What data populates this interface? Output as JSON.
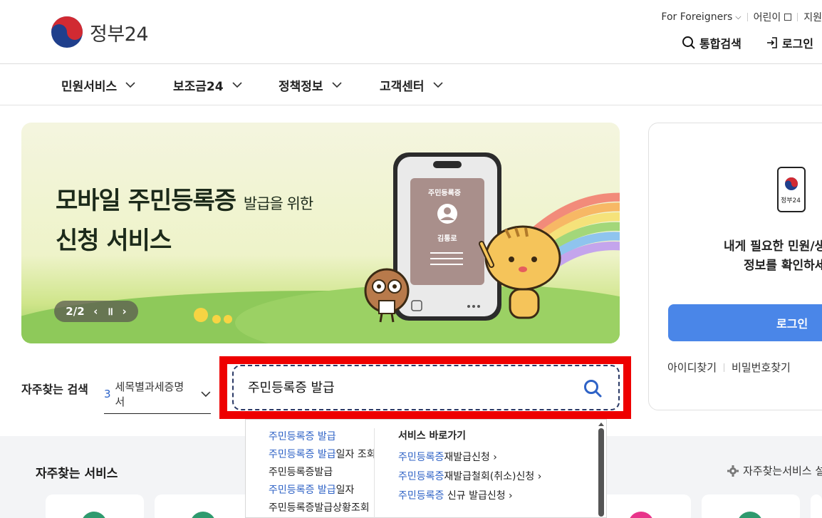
{
  "header": {
    "logo_text": "정부24",
    "util_links": [
      "For Foreigners",
      "어린이",
      "지원"
    ],
    "search_label": "통합검색",
    "login_label": "로그인"
  },
  "gnb": [
    "민원서비스",
    "보조금24",
    "정책정보",
    "고객센터"
  ],
  "banner": {
    "title_main": "모바일 주민등록증",
    "title_small": "발급을 위한",
    "title_line2": "신청 서비스",
    "card_label": "주민등록증",
    "card_name": "김통로",
    "pager": "2/2"
  },
  "login_card": {
    "icon_label": "정부24",
    "message_line1": "내게 필요한 민원/생",
    "message_line2": "정보를 확인하세",
    "login_button": "로그인",
    "find_id": "아이디찾기",
    "find_pw": "비밀번호찾기"
  },
  "search": {
    "freq_label": "자주찾는 검색",
    "freq_num": "3",
    "freq_text": "세목별과세증명서",
    "query": "주민등록증 발급"
  },
  "dropdown": {
    "suggestions": [
      {
        "hl": "주민등록증 발급",
        "rest": ""
      },
      {
        "hl": "주민등록증 발급",
        "rest": "일자 조회"
      },
      {
        "hl": "",
        "rest": "주민등록증발급"
      },
      {
        "hl": "주민등록증 발급",
        "rest": "일자"
      },
      {
        "hl": "",
        "rest": "주민등록증발급상황조회"
      }
    ],
    "shortcut_title": "서비스 바로가기",
    "shortcuts": [
      {
        "hl": "주민등록증",
        "rest": "재발급신청"
      },
      {
        "hl": "주민등록증",
        "rest": "재발급철회(취소)신청"
      },
      {
        "hl": "주민등록증",
        "rest": " 신규 발급신청"
      }
    ]
  },
  "services": {
    "title": "자주찾는 서비스",
    "setting": "자주찾는서비스 설"
  },
  "colors": {
    "accent": "#4a86e8",
    "highlight_border": "#ee0000",
    "link_blue": "#2e62c6"
  }
}
